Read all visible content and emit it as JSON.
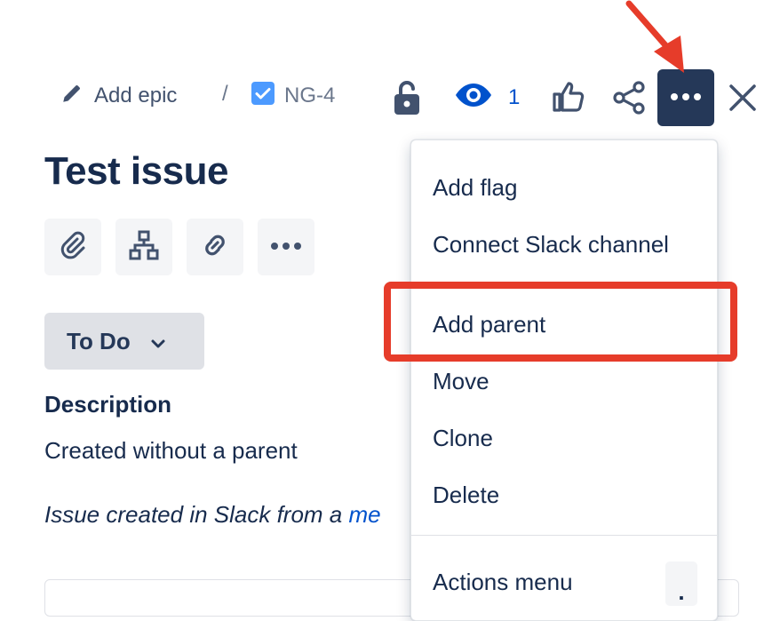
{
  "breadcrumb": {
    "epic_label": "Add epic",
    "separator": "/",
    "issue_key": "NG-4"
  },
  "toolbar": {
    "watch_count": "1",
    "icons": [
      "lock-icon",
      "eye-icon",
      "thumbs-up-icon",
      "share-icon",
      "more-icon",
      "close-icon"
    ]
  },
  "issue": {
    "title": "Test issue",
    "quick_actions": [
      "attachment-icon",
      "hierarchy-icon",
      "link-icon",
      "more-icon"
    ],
    "status": "To Do",
    "description_heading": "Description",
    "description_text": "Created without a parent",
    "slack_note_prefix": "Issue created in Slack from a ",
    "slack_note_link": "me"
  },
  "menu": {
    "items": [
      "Add flag",
      "Connect Slack channel",
      "Add parent",
      "Move",
      "Clone",
      "Delete"
    ],
    "footer_item": "Actions menu",
    "footer_shortcut": "."
  },
  "annotation": {
    "highlight_color": "#e63c2a",
    "highlighted_item": "Add parent"
  },
  "colors": {
    "text": "#172b4d",
    "link": "#0052cc",
    "more_button_bg": "#253858",
    "checkbox": "#4c9aff"
  }
}
